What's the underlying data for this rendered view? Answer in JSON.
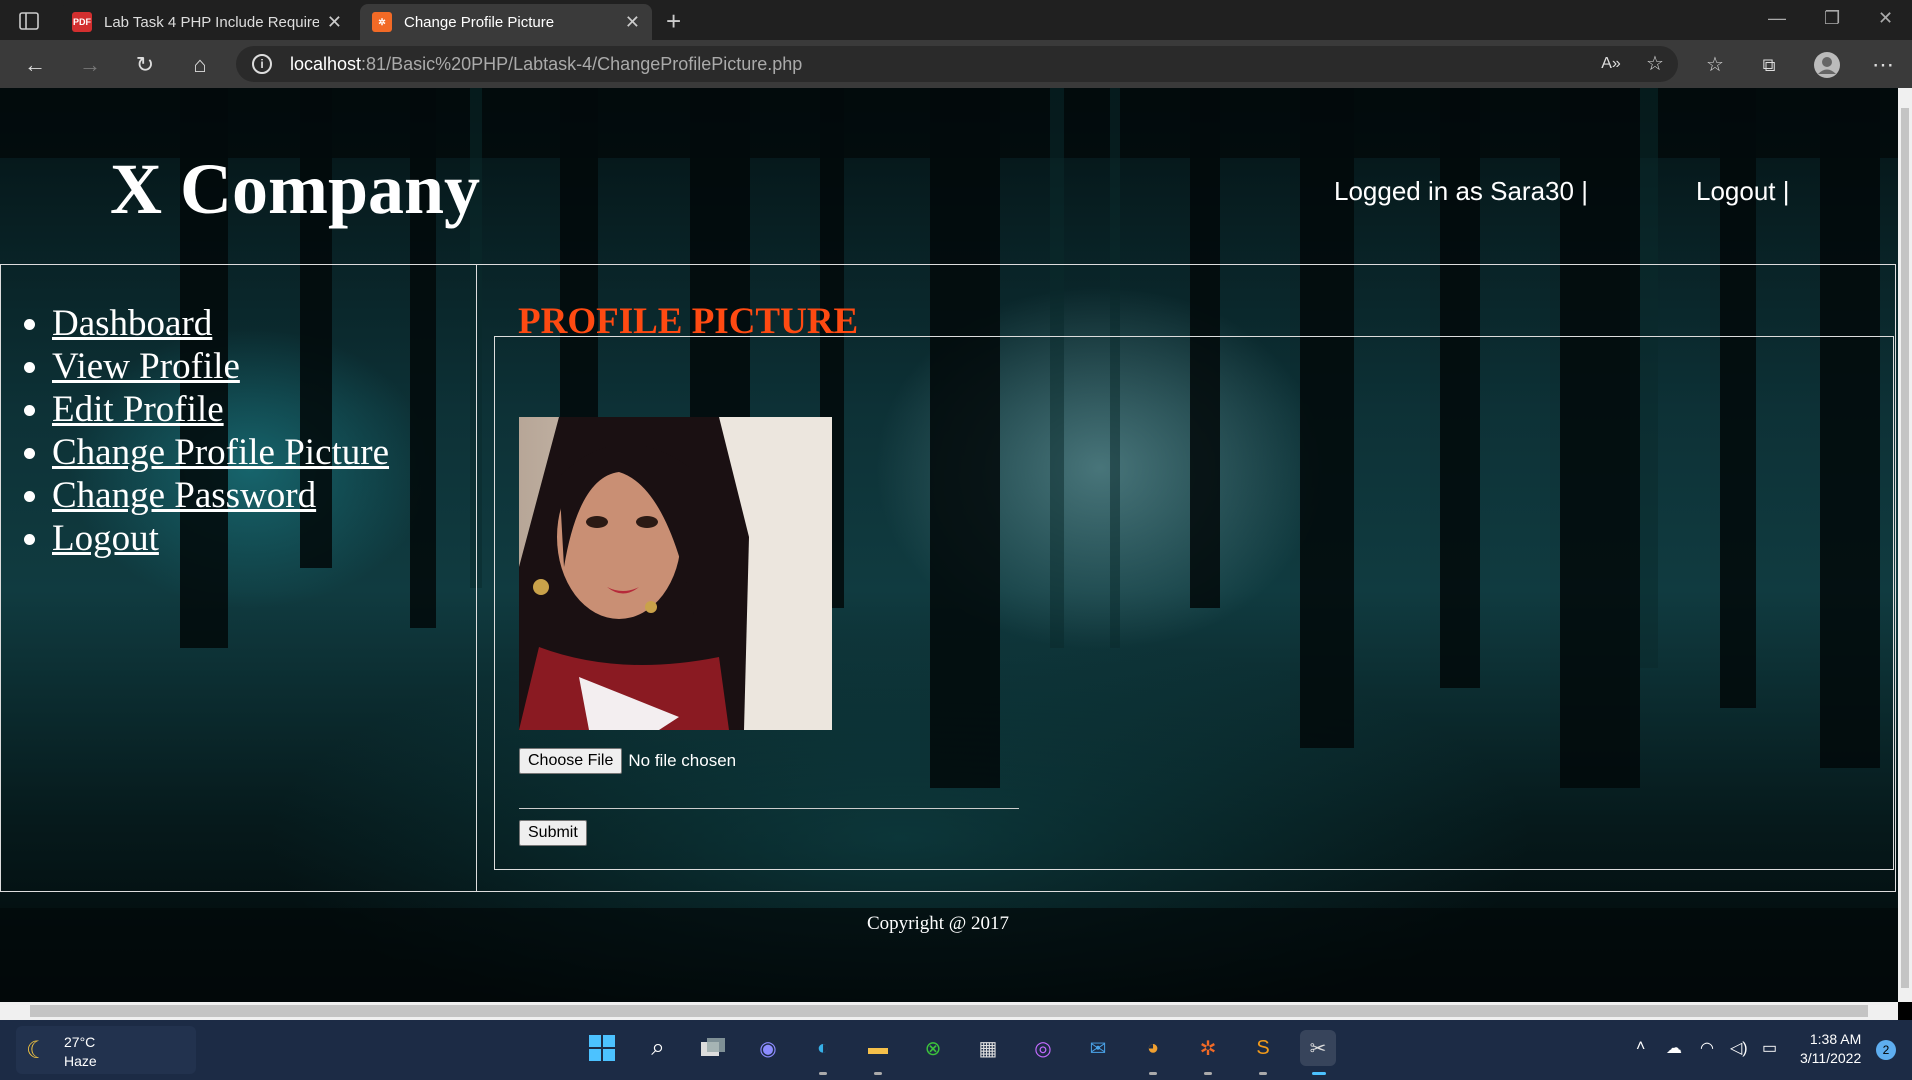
{
  "browser": {
    "tabs": [
      {
        "title": "Lab Task 4 PHP Include Require",
        "favicon": "pdf-icon",
        "favicon_color": "#d32f2f"
      },
      {
        "title": "Change Profile Picture",
        "favicon": "xampp-icon",
        "favicon_color": "#f26a26"
      }
    ],
    "url_host": "localhost",
    "url_rest": ":81/Basic%20PHP/Labtask-4/ChangeProfilePicture.php"
  },
  "header": {
    "logo": "X Company",
    "logged_in": "Logged in as Sara30 |",
    "logout": "Logout |"
  },
  "sidebar": {
    "items": [
      {
        "label": "Dashboard"
      },
      {
        "label": "View Profile"
      },
      {
        "label": "Edit Profile"
      },
      {
        "label": "Change Profile Picture"
      },
      {
        "label": "Change Password"
      },
      {
        "label": "Logout"
      }
    ]
  },
  "main": {
    "legend": "PROFILE PICTURE",
    "legend_color": "#ff4a12",
    "choose_file": "Choose File",
    "no_file": "No file chosen",
    "submit": "Submit"
  },
  "footer": {
    "copyright": "Copyright @ 2017"
  },
  "taskbar": {
    "temperature": "27°C",
    "condition": "Haze",
    "time": "1:38 AM",
    "date": "3/11/2022",
    "notifications": "2"
  }
}
